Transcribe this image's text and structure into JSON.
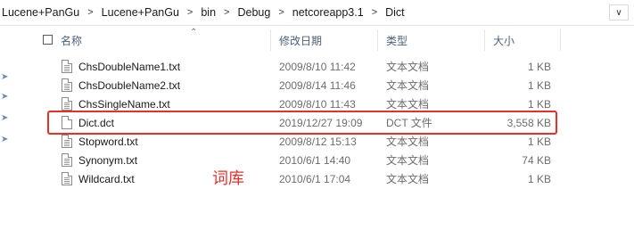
{
  "breadcrumb": {
    "items": [
      "Lucene+PanGu",
      "Lucene+PanGu",
      "bin",
      "Debug",
      "netcoreapp3.1",
      "Dict"
    ],
    "separator": ">",
    "dropdown_icon": "chevron-down-icon"
  },
  "columns": {
    "name": "名称",
    "date": "修改日期",
    "type": "类型",
    "size": "大小",
    "sort_icon": "sort-ascending-icon"
  },
  "files": [
    {
      "name": "ChsDoubleName1.txt",
      "date": "2009/8/10 11:42",
      "type": "文本文档",
      "size": "1 KB"
    },
    {
      "name": "ChsDoubleName2.txt",
      "date": "2009/8/14 11:46",
      "type": "文本文档",
      "size": "1 KB"
    },
    {
      "name": "ChsSingleName.txt",
      "date": "2009/8/10 11:43",
      "type": "文本文档",
      "size": "1 KB"
    },
    {
      "name": "Dict.dct",
      "date": "2019/12/27 19:09",
      "type": "DCT 文件",
      "size": "3,558 KB"
    },
    {
      "name": "Stopword.txt",
      "date": "2009/8/12 15:13",
      "type": "文本文档",
      "size": "1 KB"
    },
    {
      "name": "Synonym.txt",
      "date": "2010/6/1 14:40",
      "type": "文本文档",
      "size": "74 KB"
    },
    {
      "name": "Wildcard.txt",
      "date": "2010/6/1 17:04",
      "type": "文本文档",
      "size": "1 KB"
    }
  ],
  "annotation": {
    "text": "词库",
    "color": "#e8302a"
  },
  "colors": {
    "header_text": "#4c607a",
    "highlight_border": "#e8302a"
  }
}
